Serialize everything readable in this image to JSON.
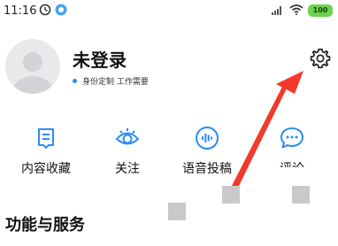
{
  "status_bar": {
    "time": "11:16",
    "battery": "100"
  },
  "profile": {
    "username": "未登录",
    "subtitle": "身份定制 工作需要"
  },
  "quick_actions": [
    {
      "label": "内容收藏",
      "icon": "bookmark-icon"
    },
    {
      "label": "关注",
      "icon": "eye-icon"
    },
    {
      "label": "语音投稿",
      "icon": "voice-icon"
    },
    {
      "label": "评论",
      "icon": "comment-icon"
    }
  ],
  "section": {
    "title": "功能与服务"
  },
  "colors": {
    "accent": "#2c8cf4",
    "arrow": "#f2392b",
    "battery": "#6ed24f"
  }
}
